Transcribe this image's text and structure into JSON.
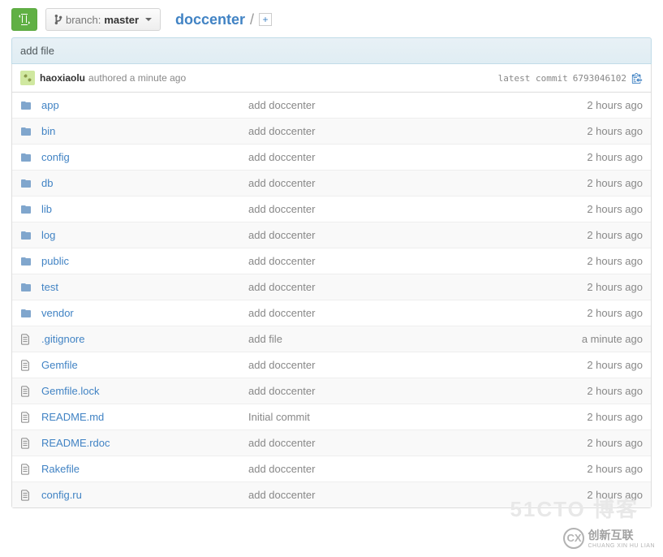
{
  "toolbar": {
    "branch_label": "branch:",
    "branch_name": "master"
  },
  "breadcrumb": {
    "repo": "doccenter",
    "separator": "/"
  },
  "commit_bar": {
    "message": "add file"
  },
  "author_row": {
    "name": "haoxiaolu",
    "action": "authored",
    "time": "a minute ago",
    "latest_label": "latest commit",
    "sha": "6793046102"
  },
  "files": [
    {
      "type": "dir",
      "name": "app",
      "msg": "add doccenter",
      "time": "2 hours ago"
    },
    {
      "type": "dir",
      "name": "bin",
      "msg": "add doccenter",
      "time": "2 hours ago"
    },
    {
      "type": "dir",
      "name": "config",
      "msg": "add doccenter",
      "time": "2 hours ago"
    },
    {
      "type": "dir",
      "name": "db",
      "msg": "add doccenter",
      "time": "2 hours ago"
    },
    {
      "type": "dir",
      "name": "lib",
      "msg": "add doccenter",
      "time": "2 hours ago"
    },
    {
      "type": "dir",
      "name": "log",
      "msg": "add doccenter",
      "time": "2 hours ago"
    },
    {
      "type": "dir",
      "name": "public",
      "msg": "add doccenter",
      "time": "2 hours ago"
    },
    {
      "type": "dir",
      "name": "test",
      "msg": "add doccenter",
      "time": "2 hours ago"
    },
    {
      "type": "dir",
      "name": "vendor",
      "msg": "add doccenter",
      "time": "2 hours ago"
    },
    {
      "type": "file",
      "name": ".gitignore",
      "msg": "add file",
      "time": "a minute ago"
    },
    {
      "type": "file",
      "name": "Gemfile",
      "msg": "add doccenter",
      "time": "2 hours ago"
    },
    {
      "type": "file",
      "name": "Gemfile.lock",
      "msg": "add doccenter",
      "time": "2 hours ago"
    },
    {
      "type": "file",
      "name": "README.md",
      "msg": "Initial commit",
      "time": "2 hours ago"
    },
    {
      "type": "file",
      "name": "README.rdoc",
      "msg": "add doccenter",
      "time": "2 hours ago"
    },
    {
      "type": "file",
      "name": "Rakefile",
      "msg": "add doccenter",
      "time": "2 hours ago"
    },
    {
      "type": "file",
      "name": "config.ru",
      "msg": "add doccenter",
      "time": "2 hours ago"
    }
  ],
  "watermark": {
    "ghost": "51CTO 博客",
    "cn": "创新互联",
    "sub": "CHUANG XIN HU LIAN"
  }
}
